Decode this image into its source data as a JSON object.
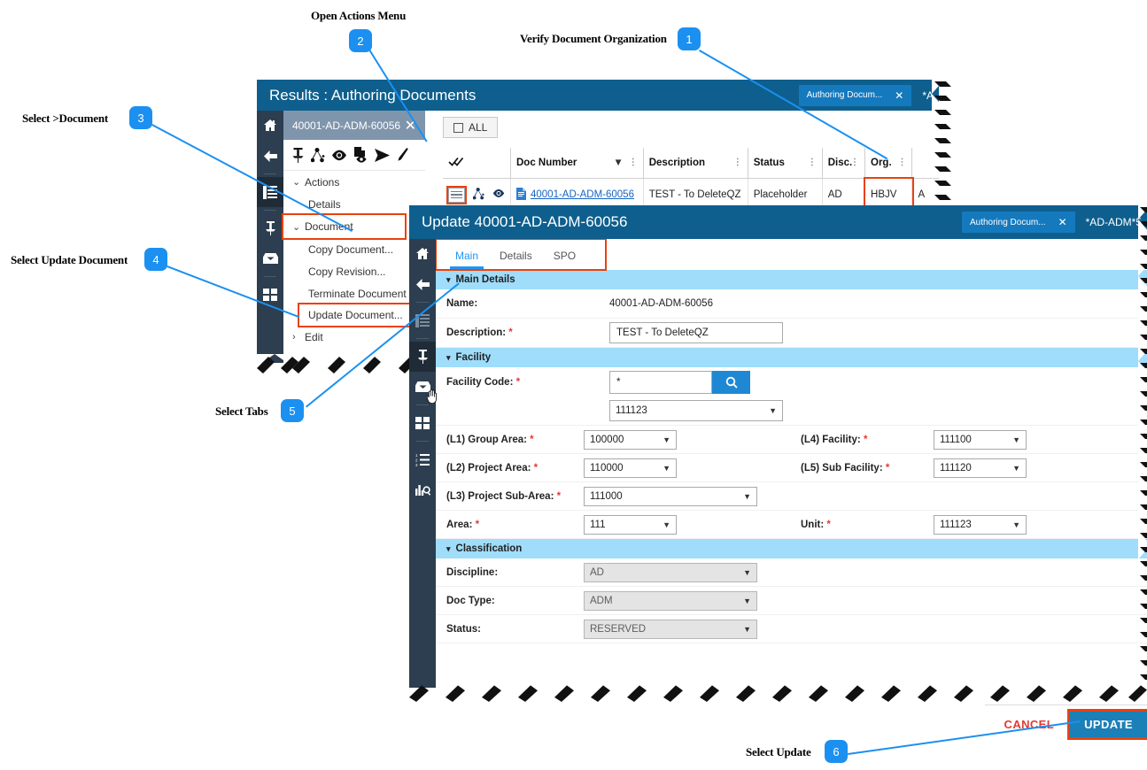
{
  "annotations": [
    {
      "id": "1",
      "label": "Verify Document Organization"
    },
    {
      "id": "2",
      "label": "Open Actions Menu"
    },
    {
      "id": "3",
      "label": "Select  >Document"
    },
    {
      "id": "4",
      "label": "Select Update Document"
    },
    {
      "id": "5",
      "label": "Select Tabs"
    },
    {
      "id": "6",
      "label": "Select Update"
    }
  ],
  "results_window": {
    "title": "Results : Authoring Documents",
    "title_tab": {
      "label": "Authoring Docum...",
      "close": "✕"
    },
    "title_extra": "*A",
    "doc_tab": {
      "label": "40001-AD-ADM-60056",
      "close": "✕"
    },
    "toolbar_icons": [
      "pin-icon",
      "share-node-icon",
      "eye-icon",
      "doc-preview-icon",
      "send-icon",
      "pencil-icon"
    ],
    "rail_icons": [
      "home-icon",
      "back-arrow-icon",
      "list-icon",
      "pin-icon",
      "inbox-icon",
      "grid-icon"
    ],
    "actions": {
      "header": "Actions",
      "header_caret": "⌄",
      "items": [
        {
          "label": "Details",
          "caret": "",
          "indent": true,
          "highlight": false
        },
        {
          "label": "Document",
          "caret": "⌄",
          "indent": false,
          "highlight": true
        },
        {
          "label": "Copy Document...",
          "caret": "",
          "indent": true,
          "highlight": false
        },
        {
          "label": "Copy Revision...",
          "caret": "",
          "indent": true,
          "highlight": false
        },
        {
          "label": "Terminate Document",
          "caret": "",
          "indent": true,
          "highlight": false
        },
        {
          "label": "Update Document...",
          "caret": "",
          "indent": true,
          "highlight": true
        },
        {
          "label": "Edit",
          "caret": "›",
          "indent": false,
          "highlight": false
        }
      ]
    },
    "all_button": "ALL",
    "grid": {
      "columns": [
        {
          "label": "",
          "width": "56",
          "filter": false,
          "kebab": false
        },
        {
          "label": "Doc Number",
          "width": "140",
          "filter": true,
          "kebab": true
        },
        {
          "label": "Description",
          "width": "106",
          "filter": false,
          "kebab": true
        },
        {
          "label": "Status",
          "width": "80",
          "filter": false,
          "kebab": true
        },
        {
          "label": "Disc.",
          "width": "42",
          "filter": false,
          "kebab": true
        },
        {
          "label": "Org.",
          "width": "50",
          "filter": false,
          "kebab": true
        },
        {
          "label": "",
          "width": "26",
          "filter": false,
          "kebab": false
        }
      ],
      "select_all_icon": "double-check-icon",
      "rows": [
        {
          "doc_number": "40001-AD-ADM-60056",
          "description": "TEST - To DeleteQZ",
          "status": "Placeholder",
          "discipline": "AD",
          "org": "HBJV",
          "extra": "A"
        }
      ]
    }
  },
  "update_window": {
    "title": "Update 40001-AD-ADM-60056",
    "title_tab": {
      "label": "Authoring Docum...",
      "close": "✕"
    },
    "title_extra": "*AD-ADM*5",
    "rail_icons": [
      "home-icon",
      "back-arrow-icon",
      "list-icon",
      "pin-icon",
      "inbox-icon",
      "grid-icon",
      "numbered-list-icon",
      "report-search-icon"
    ],
    "tabs": [
      {
        "label": "Main",
        "selected": true
      },
      {
        "label": "Details",
        "selected": false
      },
      {
        "label": "SPO",
        "selected": false
      }
    ],
    "sections": {
      "main_details": {
        "title": "Main Details",
        "caret": "▾",
        "name_label": "Name:",
        "name_value": "40001-AD-ADM-60056",
        "description_label": "Description:",
        "description_value": "TEST - To DeleteQZ"
      },
      "facility": {
        "title": "Facility",
        "caret": "▾",
        "facility_code_label": "Facility Code:",
        "facility_code_value": "*",
        "facility_search_icon": "search-icon",
        "facility_select_value": "111123",
        "fields": [
          {
            "label": "(L1) Group Area:",
            "value": "100000",
            "required": true,
            "col": "left",
            "width": "105"
          },
          {
            "label": "(L4) Facility:",
            "value": "111100",
            "required": true,
            "col": "right",
            "width": "105"
          },
          {
            "label": "(L2) Project Area:",
            "value": "110000",
            "required": true,
            "col": "left",
            "width": "105"
          },
          {
            "label": "(L5) Sub Facility:",
            "value": "111120",
            "required": true,
            "col": "right",
            "width": "105"
          },
          {
            "label": "(L3) Project Sub-Area:",
            "value": "111000",
            "required": true,
            "col": "left",
            "width": "196"
          },
          {
            "label": "Area:",
            "value": "111",
            "required": true,
            "col": "left",
            "width": "105"
          },
          {
            "label": "Unit:",
            "value": "111123",
            "required": true,
            "col": "right",
            "width": "105"
          }
        ]
      },
      "classification": {
        "title": "Classification",
        "caret": "▾",
        "fields": [
          {
            "label": "Discipline:",
            "value": "AD",
            "disabled": true
          },
          {
            "label": "Doc Type:",
            "value": "ADM",
            "disabled": true
          },
          {
            "label": "Status:",
            "value": "RESERVED",
            "disabled": true
          }
        ]
      }
    },
    "footer": {
      "cancel": "CANCEL",
      "update": "UPDATE"
    }
  },
  "colors": {
    "title_bar": "#0e5f8e",
    "rail": "#2c3e50",
    "accent_blue": "#1b90f0",
    "highlight_orange": "#e8420e",
    "section_blue": "#9fddfb",
    "required_red": "#e53935",
    "update_button": "#1b7fb8"
  }
}
